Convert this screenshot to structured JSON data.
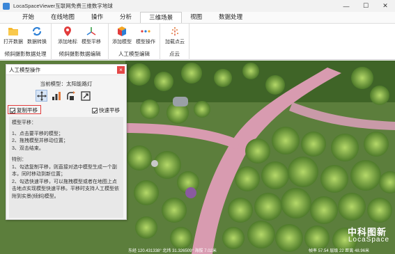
{
  "window": {
    "title": "LocaSpaceViewer互联网免费三维数字地球",
    "minimize": "—",
    "maximize": "☐",
    "close": "✕"
  },
  "menu": {
    "tabs": [
      "开始",
      "在线地图",
      "操作",
      "分析",
      "三维场景",
      "视图",
      "数据处理"
    ],
    "active_index": 4
  },
  "ribbon": {
    "groups": [
      {
        "label": "倾斜摄影数据处理",
        "buttons": [
          {
            "label": "打开数据",
            "icon": "folder-icon"
          },
          {
            "label": "数据转换",
            "icon": "refresh-icon"
          }
        ]
      },
      {
        "label": "倾斜摄影数据编辑",
        "buttons": [
          {
            "label": "添加地标",
            "icon": "map-pin-icon"
          },
          {
            "label": "模型平移",
            "icon": "axes-icon"
          }
        ]
      },
      {
        "label": "人工模型编辑",
        "buttons": [
          {
            "label": "添加模型",
            "icon": "cube-icon"
          },
          {
            "label": "模型操作",
            "icon": "dots-icon"
          }
        ]
      },
      {
        "label": "点云",
        "buttons": [
          {
            "label": "加载点云",
            "icon": "pointcloud-icon"
          }
        ]
      }
    ]
  },
  "panel": {
    "title": "人工模型操作",
    "close_label": "×",
    "current_model_label": "当前模型：",
    "current_model_value": "太阳能路灯",
    "copy_move_label": "复制平移",
    "quick_move_label": "快速平移",
    "help": {
      "heading": "模型平移：",
      "steps": [
        "1、点击要平移的模型；",
        "2、拖拽模型并移动位置；",
        "3、双击结束。"
      ],
      "note_heading": "特别：",
      "notes": [
        "1、勾选复制平移，则直接对选中模型生成一个副本，同时移动到新位置；",
        "2、勾选快速平移，可以拖拽模型或者在地图上点击地点实现模型快速平移。平移时支持人工模型依附到实景(倾斜)模型。"
      ]
    }
  },
  "map": {
    "watermark_cn": "中科图新",
    "watermark_en": "LocaSpace",
    "status_left": "东经 120.431338° 北纬 31.326509° 海拔 7.02米",
    "status_right": "帧率 57.54 层级 22 距离 48.96米"
  }
}
